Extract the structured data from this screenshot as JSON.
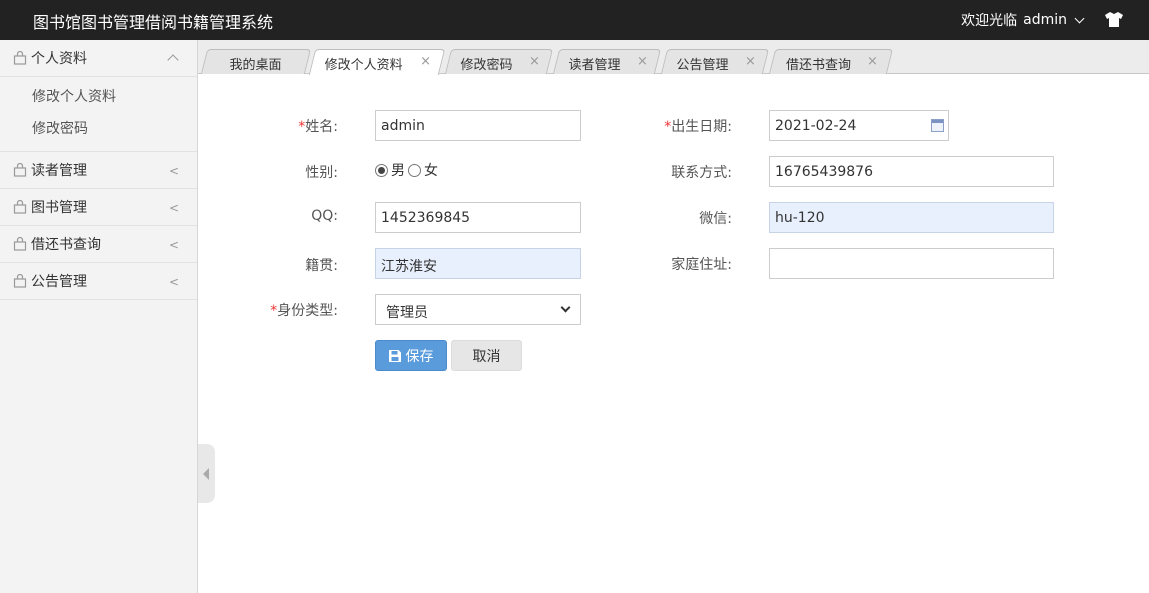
{
  "header": {
    "title": "图书馆图书管理借阅书籍管理系统",
    "welcome": "欢迎光临",
    "username": "admin"
  },
  "sidebar": {
    "groups": [
      {
        "label": "个人资料",
        "expanded": true,
        "items": [
          "修改个人资料",
          "修改密码"
        ]
      },
      {
        "label": "读者管理",
        "arrow": "<"
      },
      {
        "label": "图书管理",
        "arrow": "<"
      },
      {
        "label": "借还书查询",
        "arrow": "<"
      },
      {
        "label": "公告管理",
        "arrow": "<"
      }
    ]
  },
  "tabs": [
    {
      "label": "我的桌面"
    },
    {
      "label": "修改个人资料",
      "close": "×",
      "active": true
    },
    {
      "label": "修改密码",
      "close": "×"
    },
    {
      "label": "读者管理",
      "close": "×"
    },
    {
      "label": "公告管理",
      "close": "×"
    },
    {
      "label": "借还书查询",
      "close": "×"
    }
  ],
  "form": {
    "required_mark": "*",
    "name": {
      "label": "姓名:",
      "value": "admin"
    },
    "birthday": {
      "label": "出生日期:",
      "value": "2021-02-24"
    },
    "gender": {
      "label": "性别:",
      "options": [
        "男",
        "女"
      ],
      "selected": "男"
    },
    "contact": {
      "label": "联系方式:",
      "value": "16765439876"
    },
    "qq": {
      "label": "QQ:",
      "value": "1452369845"
    },
    "wechat": {
      "label": "微信:",
      "value": "hu-120"
    },
    "origin": {
      "label": "籍贯:",
      "value": "江苏淮安"
    },
    "address": {
      "label": "家庭住址:",
      "value": ""
    },
    "identity": {
      "label": "身份类型:",
      "value": "管理员"
    }
  },
  "buttons": {
    "save": "保存",
    "cancel": "取消"
  },
  "colors": {
    "topbar": "#222222",
    "primary_button": "#5a9bdc",
    "autofill": "#e8f0fe",
    "required": "#ee3333"
  }
}
